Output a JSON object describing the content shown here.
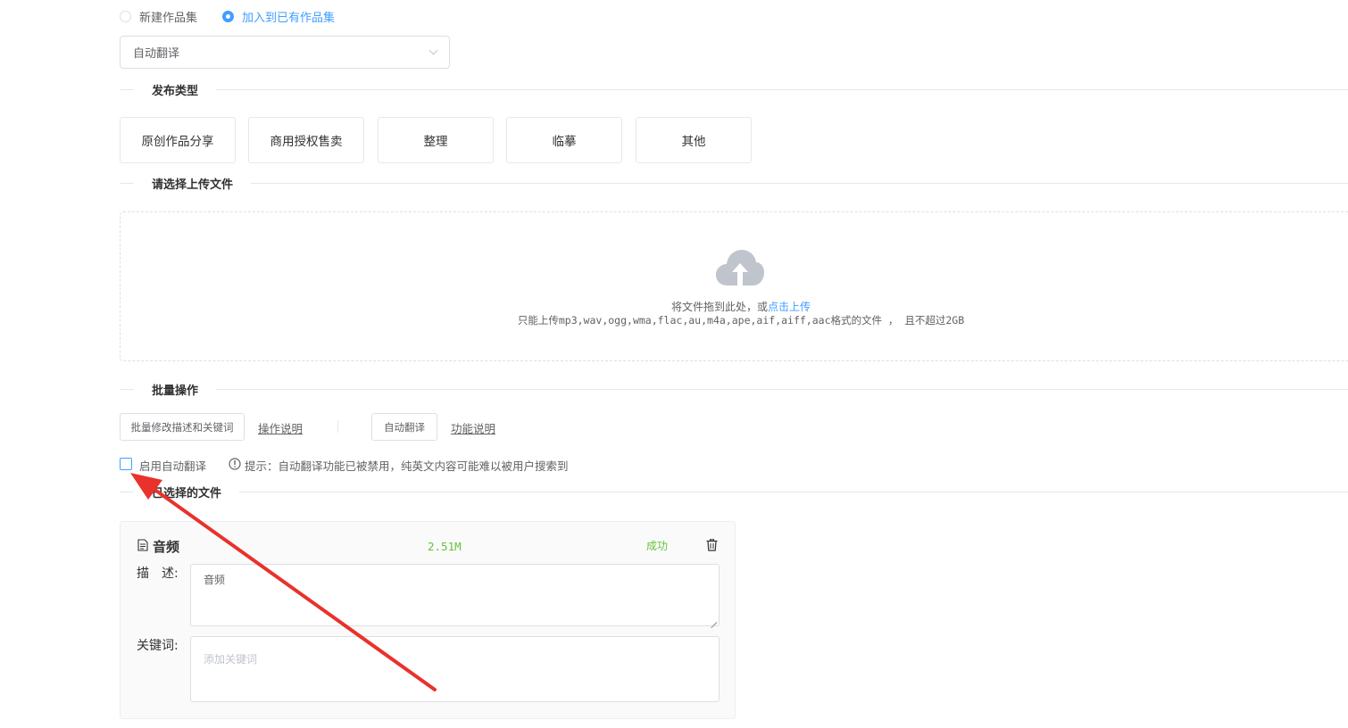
{
  "collection": {
    "radio_new": "新建作品集",
    "radio_existing": "加入到已有作品集",
    "select_value": "自动翻译"
  },
  "release_type": {
    "section_title": "发布类型",
    "options": [
      "原创作品分享",
      "商用授权售卖",
      "整理",
      "临摹",
      "其他"
    ]
  },
  "upload": {
    "section_title": "请选择上传文件",
    "drag_text": "将文件拖到此处，或",
    "click_upload": "点击上传",
    "hint": "只能上传mp3,wav,ogg,wma,flac,au,m4a,ape,aif,aiff,aac格式的文件 ， 且不超过2GB"
  },
  "batch": {
    "section_title": "批量操作",
    "edit_button": "批量修改描述和关键词",
    "edit_help": "操作说明",
    "auto_translate_button": "自动翻译",
    "auto_translate_help": "功能说明",
    "enable_auto_translate": "启用自动翻译",
    "tip": "提示：自动翻译功能已被禁用，纯英文内容可能难以被用户搜索到"
  },
  "selected_files": {
    "section_title": "已选择的文件",
    "file": {
      "name": "音频",
      "size": "2.51M",
      "status": "成功",
      "desc_label": "描　述:",
      "desc_value": "音频",
      "keywords_label": "关键词:",
      "keywords_placeholder": "添加关键词"
    }
  },
  "colors": {
    "accent": "#409eff",
    "success": "#67c23a",
    "annotation": "#e8322b"
  }
}
